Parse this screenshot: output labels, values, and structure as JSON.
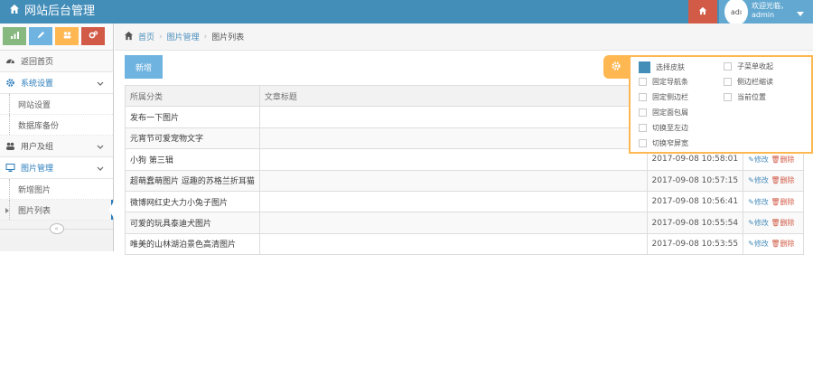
{
  "app": {
    "title": "网站后台管理"
  },
  "user": {
    "avatar_alt": "adı",
    "greeting": "欢迎光临，",
    "name": "admin"
  },
  "colors": {
    "navbar": "#438eb9",
    "accent": "#2b7dbc",
    "warning": "#ffb752",
    "danger": "#d15b47"
  },
  "shortcuts": [
    {
      "icon": "signal-icon",
      "color": "#87b87f"
    },
    {
      "icon": "pencil-icon",
      "color": "#6fb3e0"
    },
    {
      "icon": "group-icon",
      "color": "#ffb752"
    },
    {
      "icon": "cogs-icon",
      "color": "#d15b47"
    }
  ],
  "sidebar": {
    "items": [
      {
        "label": "返回首页",
        "icon": "dashboard-icon"
      },
      {
        "label": "系统设置",
        "icon": "gear-icon",
        "children": [
          "网站设置",
          "数据库备份"
        ]
      },
      {
        "label": "用户及组",
        "icon": "users-icon"
      },
      {
        "label": "图片管理",
        "icon": "desktop-icon",
        "children": [
          "新增图片",
          "图片列表"
        ]
      }
    ],
    "collapse_label": "«"
  },
  "breadcrumb": {
    "home": "首页",
    "section": "图片管理",
    "current": "图片列表"
  },
  "toolbar": {
    "add_label": "新增"
  },
  "table": {
    "headers": [
      "所属分类",
      "文章标题",
      "",
      ""
    ],
    "rows": [
      {
        "category": "发布一下图片",
        "title": "",
        "date": "",
        "edit": "",
        "del": ""
      },
      {
        "category": "元宵节可爱宠物文字",
        "title": "",
        "date": "",
        "edit": "",
        "del": ""
      },
      {
        "category": "小狗 第三辑",
        "title": "",
        "date": "2017-09-08 10:58:01",
        "edit": "修改",
        "del": "删除"
      },
      {
        "category": "超萌蠢萌图片 逗趣的苏格兰折耳猫",
        "title": "",
        "date": "2017-09-08 10:57:15",
        "edit": "修改",
        "del": "删除"
      },
      {
        "category": "微博网红史大力小兔子图片",
        "title": "",
        "date": "2017-09-08 10:56:41",
        "edit": "修改",
        "del": "删除"
      },
      {
        "category": "可爱的玩具泰迪犬图片",
        "title": "",
        "date": "2017-09-08 10:55:54",
        "edit": "修改",
        "del": "删除"
      },
      {
        "category": "唯美的山林湖泊景色高清图片",
        "title": "",
        "date": "2017-09-08 10:53:55",
        "edit": "修改",
        "del": "删除"
      }
    ]
  },
  "settings": {
    "skin_label": "选择皮肤",
    "options_left": [
      "固定导航条",
      "固定侧边栏",
      "固定面包屑",
      "切换至左边",
      "切换窄屏宽"
    ],
    "options_right": [
      "子菜单收起",
      "侧边栏缩读",
      "当前位置"
    ]
  }
}
